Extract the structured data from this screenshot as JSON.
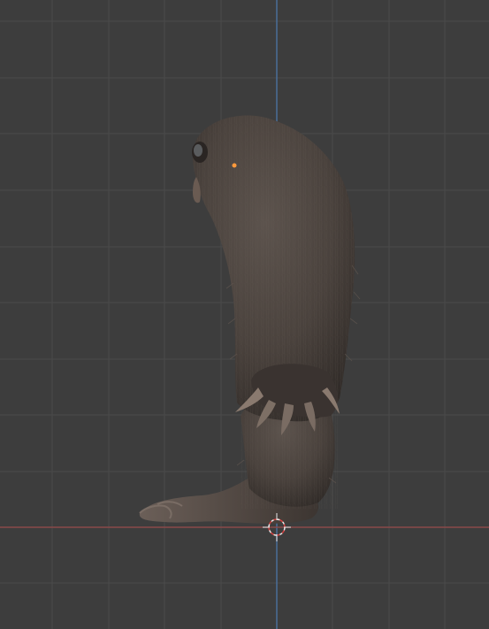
{
  "viewport": {
    "background_color": "#3d3d3d",
    "grid_color": "#4a4a4a",
    "x_axis_color": "#8a4a4a",
    "y_axis_color": "#4a6e9a",
    "origin_marker": "3d-cursor-icon",
    "selected_origin_color": "#ff9a3c"
  },
  "model": {
    "description_icon": "furry-creature-mesh",
    "fur_color_base": "#4b4440",
    "fur_color_shadow": "#2f2a27",
    "fur_color_highlight": "#6a5f58"
  }
}
